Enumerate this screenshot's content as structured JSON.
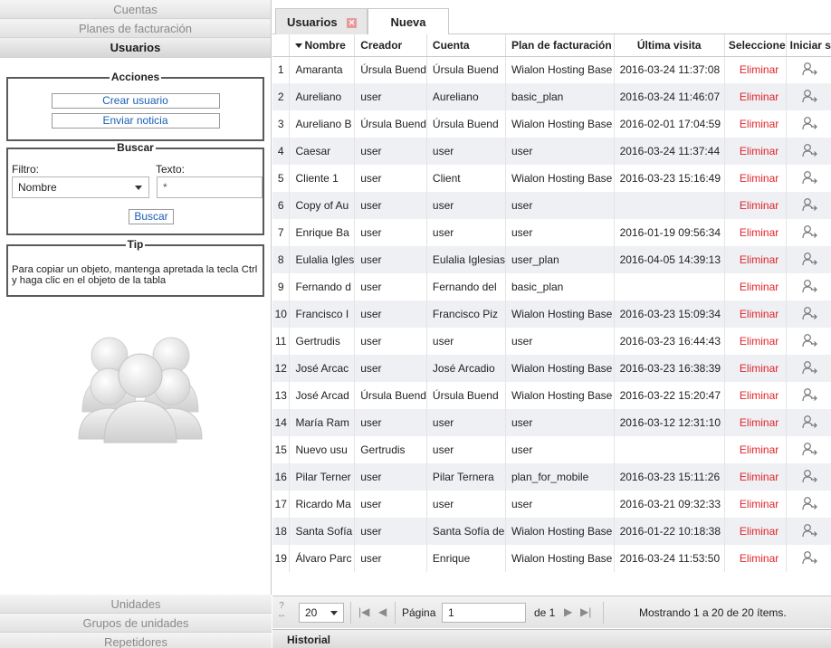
{
  "sidebar": {
    "sections_top": [
      "Cuentas",
      "Planes de facturación",
      "Usuarios"
    ],
    "sections_bottom": [
      "Unidades",
      "Grupos de unidades",
      "Repetidores"
    ],
    "actions": {
      "title": "Acciones",
      "create_user": "Crear usuario",
      "send_notice": "Enviar noticia"
    },
    "search": {
      "title": "Buscar",
      "filter_label": "Filtro:",
      "filter_value": "Nombre",
      "text_label": "Texto:",
      "text_value": "*",
      "button": "Buscar"
    },
    "tip": {
      "title": "Tip",
      "text": "Para copiar un objeto, mantenga apretada la tecla Ctrl y haga clic en el objeto de la tabla"
    }
  },
  "tabs": [
    "Usuarios",
    "Nueva"
  ],
  "table": {
    "headers": [
      "Nombre",
      "Creador",
      "Cuenta",
      "Plan de facturación",
      "Última visita",
      "Seleccione",
      "Iniciar s"
    ],
    "delete_label": "Eliminar",
    "rows": [
      {
        "n": "1",
        "name": "Amaranta",
        "creator": "Úrsula Buend",
        "account": "Úrsula Buend",
        "plan": "Wialon Hosting Base",
        "visit": "2016-03-24 11:37:08"
      },
      {
        "n": "2",
        "name": "Aureliano",
        "creator": "user",
        "account": "Aureliano",
        "plan": "basic_plan",
        "visit": "2016-03-24 11:46:07"
      },
      {
        "n": "3",
        "name": "Aureliano B",
        "creator": "Úrsula Buend",
        "account": "Úrsula Buend",
        "plan": "Wialon Hosting Base",
        "visit": "2016-02-01 17:04:59"
      },
      {
        "n": "4",
        "name": "Caesar",
        "creator": "user",
        "account": "user",
        "plan": "user",
        "visit": "2016-03-24 11:37:44"
      },
      {
        "n": "5",
        "name": "Cliente 1",
        "creator": "user",
        "account": "Client",
        "plan": "Wialon Hosting Base",
        "visit": "2016-03-23 15:16:49"
      },
      {
        "n": "6",
        "name": "Copy of Au",
        "creator": "user",
        "account": "user",
        "plan": "user",
        "visit": ""
      },
      {
        "n": "7",
        "name": "Enrique Ba",
        "creator": "user",
        "account": "user",
        "plan": "user",
        "visit": "2016-01-19 09:56:34"
      },
      {
        "n": "8",
        "name": "Eulalia Igles",
        "creator": "user",
        "account": "Eulalia Iglesias",
        "plan": "user_plan",
        "visit": "2016-04-05 14:39:13"
      },
      {
        "n": "9",
        "name": "Fernando d",
        "creator": "user",
        "account": "Fernando del",
        "plan": "basic_plan",
        "visit": ""
      },
      {
        "n": "10",
        "name": "Francisco I",
        "creator": "user",
        "account": "Francisco Piz",
        "plan": "Wialon Hosting Base",
        "visit": "2016-03-23 15:09:34"
      },
      {
        "n": "11",
        "name": "Gertrudis",
        "creator": "user",
        "account": "user",
        "plan": "user",
        "visit": "2016-03-23 16:44:43"
      },
      {
        "n": "12",
        "name": "José Arcac",
        "creator": "user",
        "account": "José Arcadio",
        "plan": "Wialon Hosting Base",
        "visit": "2016-03-23 16:38:39"
      },
      {
        "n": "13",
        "name": "José Arcad",
        "creator": "Úrsula Buend",
        "account": "Úrsula Buend",
        "plan": "Wialon Hosting Base",
        "visit": "2016-03-22 15:20:47"
      },
      {
        "n": "14",
        "name": "María Ram",
        "creator": "user",
        "account": "user",
        "plan": "user",
        "visit": "2016-03-12 12:31:10"
      },
      {
        "n": "15",
        "name": "Nuevo usu",
        "creator": "Gertrudis",
        "account": "user",
        "plan": "user",
        "visit": ""
      },
      {
        "n": "16",
        "name": "Pilar Terner",
        "creator": "user",
        "account": "Pilar Ternera",
        "plan": "plan_for_mobile",
        "visit": "2016-03-23 15:11:26"
      },
      {
        "n": "17",
        "name": "Ricardo Ma",
        "creator": "user",
        "account": "user",
        "plan": "user",
        "visit": "2016-03-21 09:32:33"
      },
      {
        "n": "18",
        "name": "Santa Sofía",
        "creator": "user",
        "account": "Santa Sofía de",
        "plan": "Wialon Hosting Base",
        "visit": "2016-01-22 10:18:38"
      },
      {
        "n": "19",
        "name": "Álvaro Parc",
        "creator": "user",
        "account": "Enrique",
        "plan": "Wialon Hosting Base",
        "visit": "2016-03-24 11:53:50"
      }
    ]
  },
  "pager": {
    "per_page": "20",
    "page_label": "Página",
    "page_value": "1",
    "of_label": "de 1",
    "showing": "Mostrando 1 a 20 de 20 ítems."
  },
  "history_label": "Historial",
  "colors": {
    "delete": "#e0242b",
    "link": "#1a5fb4"
  }
}
